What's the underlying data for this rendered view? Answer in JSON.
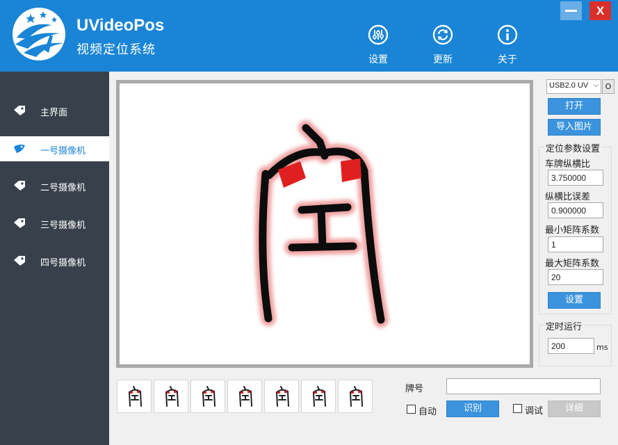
{
  "app": {
    "title": "UVideoPos",
    "subtitle": "视频定位系统"
  },
  "toolbar": {
    "settings_label": "设置",
    "update_label": "更新",
    "about_label": "关于"
  },
  "window": {
    "close_label": "X"
  },
  "sidebar": {
    "items": [
      {
        "label": "主界面"
      },
      {
        "label": "一号摄像机"
      },
      {
        "label": "二号摄像机"
      },
      {
        "label": "三号摄像机"
      },
      {
        "label": "四号摄像机"
      }
    ],
    "active_index": 1
  },
  "camera": {
    "selected": "USB2.0 UV",
    "side_button": "O",
    "open_label": "打开",
    "import_label": "导入图片"
  },
  "params": {
    "group_title": "定位参数设置",
    "aspect_label": "车牌纵横比",
    "aspect_value": "3.750000",
    "aspect_err_label": "纵横比误差",
    "aspect_err_value": "0.900000",
    "min_rect_label": "最小矩阵系数",
    "min_rect_value": "1",
    "max_rect_label": "最大矩阵系数",
    "max_rect_value": "20",
    "set_label": "设置"
  },
  "timer": {
    "group_title": "定时运行",
    "value": "200",
    "unit": "ms"
  },
  "plate": {
    "label": "牌号",
    "value": "",
    "auto_label": "自动",
    "auto_checked": false,
    "recognize_label": "识别",
    "debug_label": "调试",
    "debug_checked": false,
    "detail_label": "详细"
  },
  "colors": {
    "header": "#1a85d6",
    "sidebar": "#38414b",
    "button": "#3a93dc",
    "button_disabled": "#c9c9c9",
    "glyph_red": "#e02020"
  },
  "thumbnails_count": 7
}
